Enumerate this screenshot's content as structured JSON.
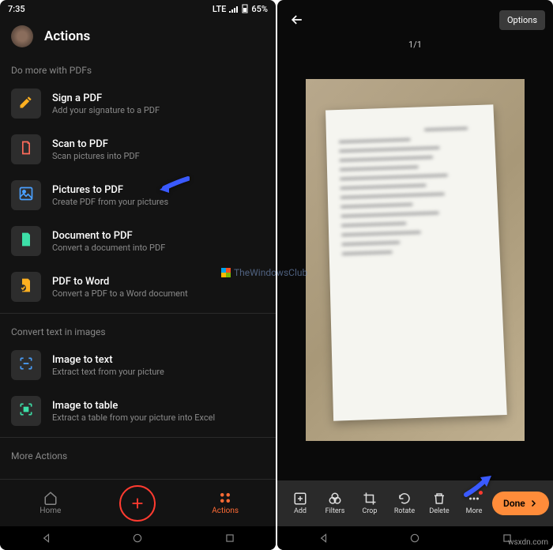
{
  "status_left": {
    "time": "7:35",
    "network": "LTE",
    "battery": "65%"
  },
  "left": {
    "title": "Actions",
    "sections": [
      {
        "header": "Do more with PDFs",
        "items": [
          {
            "title": "Sign a PDF",
            "sub": "Add your signature to a PDF",
            "icon": "sign",
            "color": "#ffb020"
          },
          {
            "title": "Scan to PDF",
            "sub": "Scan pictures into PDF",
            "icon": "scan",
            "color": "#ff6b5a"
          },
          {
            "title": "Pictures to PDF",
            "sub": "Create PDF from your pictures",
            "icon": "picture",
            "color": "#4aa0ff"
          },
          {
            "title": "Document to PDF",
            "sub": "Convert a document into PDF",
            "icon": "doc",
            "color": "#3de0a8"
          },
          {
            "title": "PDF to Word",
            "sub": "Convert a PDF to a Word document",
            "icon": "word",
            "color": "#ffb020"
          }
        ]
      },
      {
        "header": "Convert text in images",
        "items": [
          {
            "title": "Image to text",
            "sub": "Extract text from your picture",
            "icon": "imgtext",
            "color": "#4aa0ff"
          },
          {
            "title": "Image to table",
            "sub": "Extract a table from your picture into Excel",
            "icon": "imgtable",
            "color": "#3de0a8"
          }
        ]
      },
      {
        "header": "More Actions",
        "items": []
      }
    ],
    "nav": {
      "home": "Home",
      "actions": "Actions"
    }
  },
  "right": {
    "options": "Options",
    "counter": "1/1",
    "tools": {
      "add": "Add",
      "filters": "Filters",
      "crop": "Crop",
      "rotate": "Rotate",
      "delete": "Delete",
      "more": "More",
      "done": "Done"
    }
  },
  "watermark": "wsxdn.com",
  "watermark_center": "TheWindowsClub"
}
